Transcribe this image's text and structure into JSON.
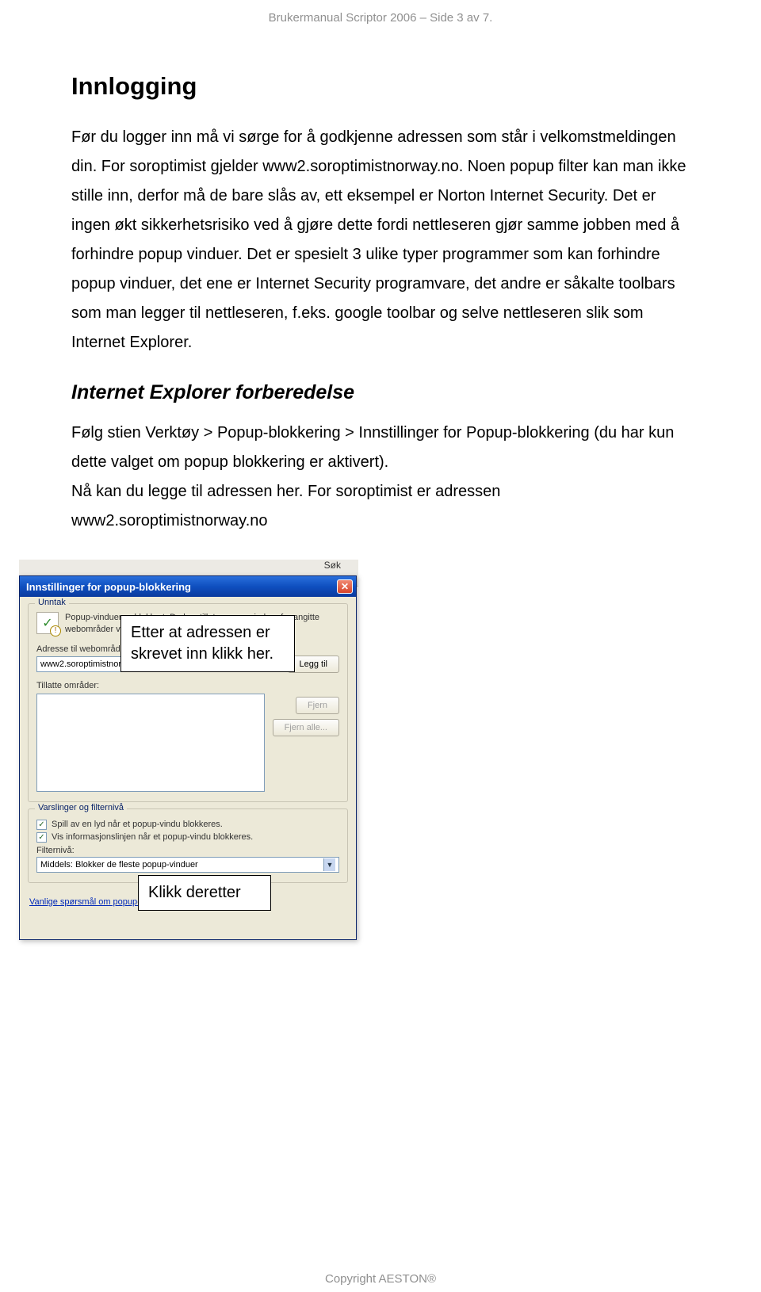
{
  "header": "Brukermanual Scriptor 2006 – Side 3 av 7.",
  "section1_title": "Innlogging",
  "section1_body": "Før du logger inn må vi sørge for å godkjenne adressen som står i velkomstmeldingen din. For soroptimist gjelder www2.soroptimistnorway.no. Noen popup filter kan man ikke stille inn, derfor må de bare slås av, ett eksempel er Norton Internet Security. Det er ingen økt sikkerhetsrisiko ved å gjøre dette fordi nettleseren gjør samme jobben med å forhindre popup vinduer. Det er spesielt 3 ulike typer programmer som kan forhindre popup vinduer, det ene er Internet Security programvare, det andre er såkalte toolbars som man legger til nettleseren, f.eks. google toolbar og selve nettleseren slik som Internet Explorer.",
  "section2_title": "Internet Explorer forberedelse",
  "section2_body": "Følg stien Verktøy > Popup-blokkering > Innstillinger for Popup-blokkering (du har kun dette valget om popup blokkering er aktivert).\nNå kan du legge til adressen her. For soroptimist er adressen www2.soroptimistnorway.no",
  "callout1": "Etter at adressen er skrevet inn klikk her.",
  "callout2": "Klikk deretter",
  "toolbar_sok": "Søk",
  "dialog": {
    "title": "Innstillinger for popup-blokkering",
    "group_unntak": "Unntak",
    "info_text": "Popup-vinduer er blokkert. Du kan tillate popup-vinduer fra angitte webområder ved å legge dem til i listen nedenfor.",
    "addr_label": "Adresse til webområde som skal tillates:",
    "addr_value": "www2.soroptimistnorway.no",
    "btn_leggtil": "Legg til",
    "tillatte_label": "Tillatte områder:",
    "btn_fjern": "Fjern",
    "btn_fjern_alle": "Fjern alle...",
    "group_varsl": "Varslinger og filternivå",
    "chk1": "Spill av en lyd når et popup-vindu blokkeres.",
    "chk2": "Vis informasjonslinjen når et popup-vindu blokkeres.",
    "filterniva_label": "Filternivå:",
    "filterniva_value": "Middels: Blokker de fleste popup-vinduer",
    "faq_link": "Vanlige spørsmål om popup-blokkering"
  },
  "footer": "Copyright AESTON®"
}
